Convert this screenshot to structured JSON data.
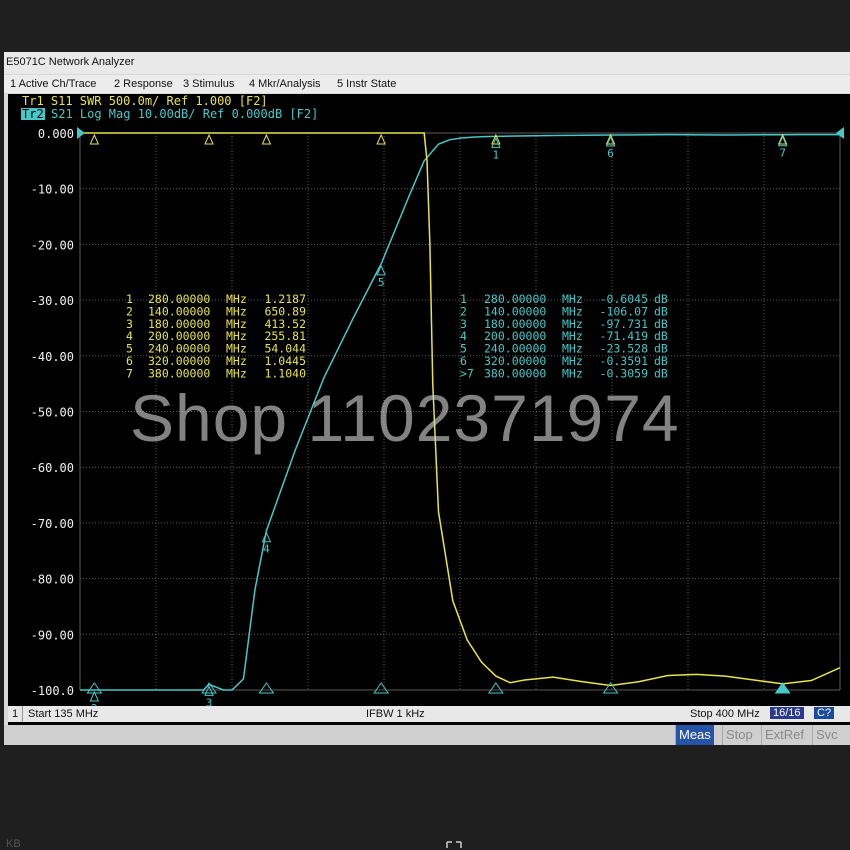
{
  "window": {
    "title": "E5071C Network Analyzer"
  },
  "menu": [
    {
      "label": "1 Active Ch/Trace"
    },
    {
      "label": "2 Response"
    },
    {
      "label": "3 Stimulus"
    },
    {
      "label": "4 Mkr/Analysis"
    },
    {
      "label": "5 Instr State"
    }
  ],
  "traces": {
    "tr1": "Tr1  S11  SWR  500.0m/  Ref  1.000  [F2]",
    "tr2_tag": "Tr2",
    "tr2": "S21  Log Mag  10.00dB/  Ref  0.000dB  [F2]"
  },
  "yaxis": {
    "labels": [
      "0.000",
      "-10.00",
      "-20.00",
      "-30.00",
      "-40.00",
      "-50.00",
      "-60.00",
      "-70.00",
      "-80.00",
      "-90.00",
      "-100.0"
    ],
    "min": -100,
    "max": 0
  },
  "markers_s11": [
    {
      "id": "1",
      "freq": "280.00000",
      "unit": "MHz",
      "value": "1.2187"
    },
    {
      "id": "2",
      "freq": "140.00000",
      "unit": "MHz",
      "value": "650.89"
    },
    {
      "id": "3",
      "freq": "180.00000",
      "unit": "MHz",
      "value": "413.52"
    },
    {
      "id": "4",
      "freq": "200.00000",
      "unit": "MHz",
      "value": "255.81"
    },
    {
      "id": "5",
      "freq": "240.00000",
      "unit": "MHz",
      "value": "54.044"
    },
    {
      "id": "6",
      "freq": "320.00000",
      "unit": "MHz",
      "value": "1.0445"
    },
    {
      "id": "7",
      "freq": "380.00000",
      "unit": "MHz",
      "value": "1.1040"
    }
  ],
  "markers_s21": [
    {
      "id": "1",
      "freq": "280.00000",
      "unit": "MHz",
      "value": "-0.6045",
      "vunit": "dB"
    },
    {
      "id": "2",
      "freq": "140.00000",
      "unit": "MHz",
      "value": "-106.07",
      "vunit": "dB"
    },
    {
      "id": "3",
      "freq": "180.00000",
      "unit": "MHz",
      "value": "-97.731",
      "vunit": "dB"
    },
    {
      "id": "4",
      "freq": "200.00000",
      "unit": "MHz",
      "value": "-71.419",
      "vunit": "dB"
    },
    {
      "id": "5",
      "freq": "240.00000",
      "unit": "MHz",
      "value": "-23.528",
      "vunit": "dB"
    },
    {
      "id": "6",
      "freq": "320.00000",
      "unit": "MHz",
      "value": "-0.3591",
      "vunit": "dB"
    },
    {
      "id": ">7",
      "freq": "380.00000",
      "unit": "MHz",
      "value": "-0.3059",
      "vunit": "dB"
    }
  ],
  "status": {
    "channel": "1",
    "start": "Start 135 MHz",
    "ifbw": "IFBW 1 kHz",
    "stop": "Stop 400 MHz",
    "sweep": "16/16",
    "cal": "C?"
  },
  "softkeys": [
    {
      "label": "Meas"
    },
    {
      "label": "Stop"
    },
    {
      "label": "ExtRef"
    },
    {
      "label": "Svc"
    }
  ],
  "watermark": "Shop 1102371974",
  "footer_text": "KB",
  "chart_data": {
    "type": "line",
    "xlim": [
      135,
      400
    ],
    "ylim": [
      -100,
      0
    ],
    "series": [
      {
        "name": "S21",
        "color": "#46c8c8",
        "x": [
          135,
          145,
          160,
          175,
          178,
          180,
          185,
          188,
          192,
          196,
          200,
          210,
          220,
          230,
          240,
          250,
          255,
          260,
          264,
          268,
          272,
          276,
          280,
          300,
          320,
          340,
          360,
          380,
          385,
          400
        ],
        "y": [
          -100,
          -100,
          -100,
          -100,
          -100,
          -99.0,
          -100,
          -100,
          -98,
          -82,
          -71.4,
          -57,
          -44,
          -33.5,
          -23.5,
          -11,
          -5,
          -2,
          -1.2,
          -0.9,
          -0.75,
          -0.65,
          -0.6,
          -0.45,
          -0.36,
          -0.3,
          -0.35,
          -0.31,
          -0.3,
          -0.3
        ]
      },
      {
        "name": "S11",
        "color": "#e8e34b",
        "x": [
          135,
          200,
          240,
          255,
          256,
          257,
          258,
          260,
          265,
          270,
          275,
          280,
          285,
          290,
          300,
          310,
          320,
          330,
          340,
          350,
          360,
          370,
          380,
          390,
          400
        ],
        "y": [
          0,
          0,
          0,
          0,
          -5,
          -20,
          -45,
          -68,
          -84,
          -91,
          -95,
          -97.5,
          -98.7,
          -98.2,
          -97.7,
          -98.5,
          -99.2,
          -98.5,
          -97.4,
          -97.2,
          -97.5,
          -98.2,
          -98.9,
          -98.3,
          -96.0
        ]
      }
    ],
    "marker_positions": [
      {
        "id": "1",
        "x": 280
      },
      {
        "id": "2",
        "x": 140
      },
      {
        "id": "3",
        "x": 180
      },
      {
        "id": "4",
        "x": 200
      },
      {
        "id": "5",
        "x": 240
      },
      {
        "id": "6",
        "x": 320
      },
      {
        "id": "7",
        "x": 380
      }
    ]
  }
}
